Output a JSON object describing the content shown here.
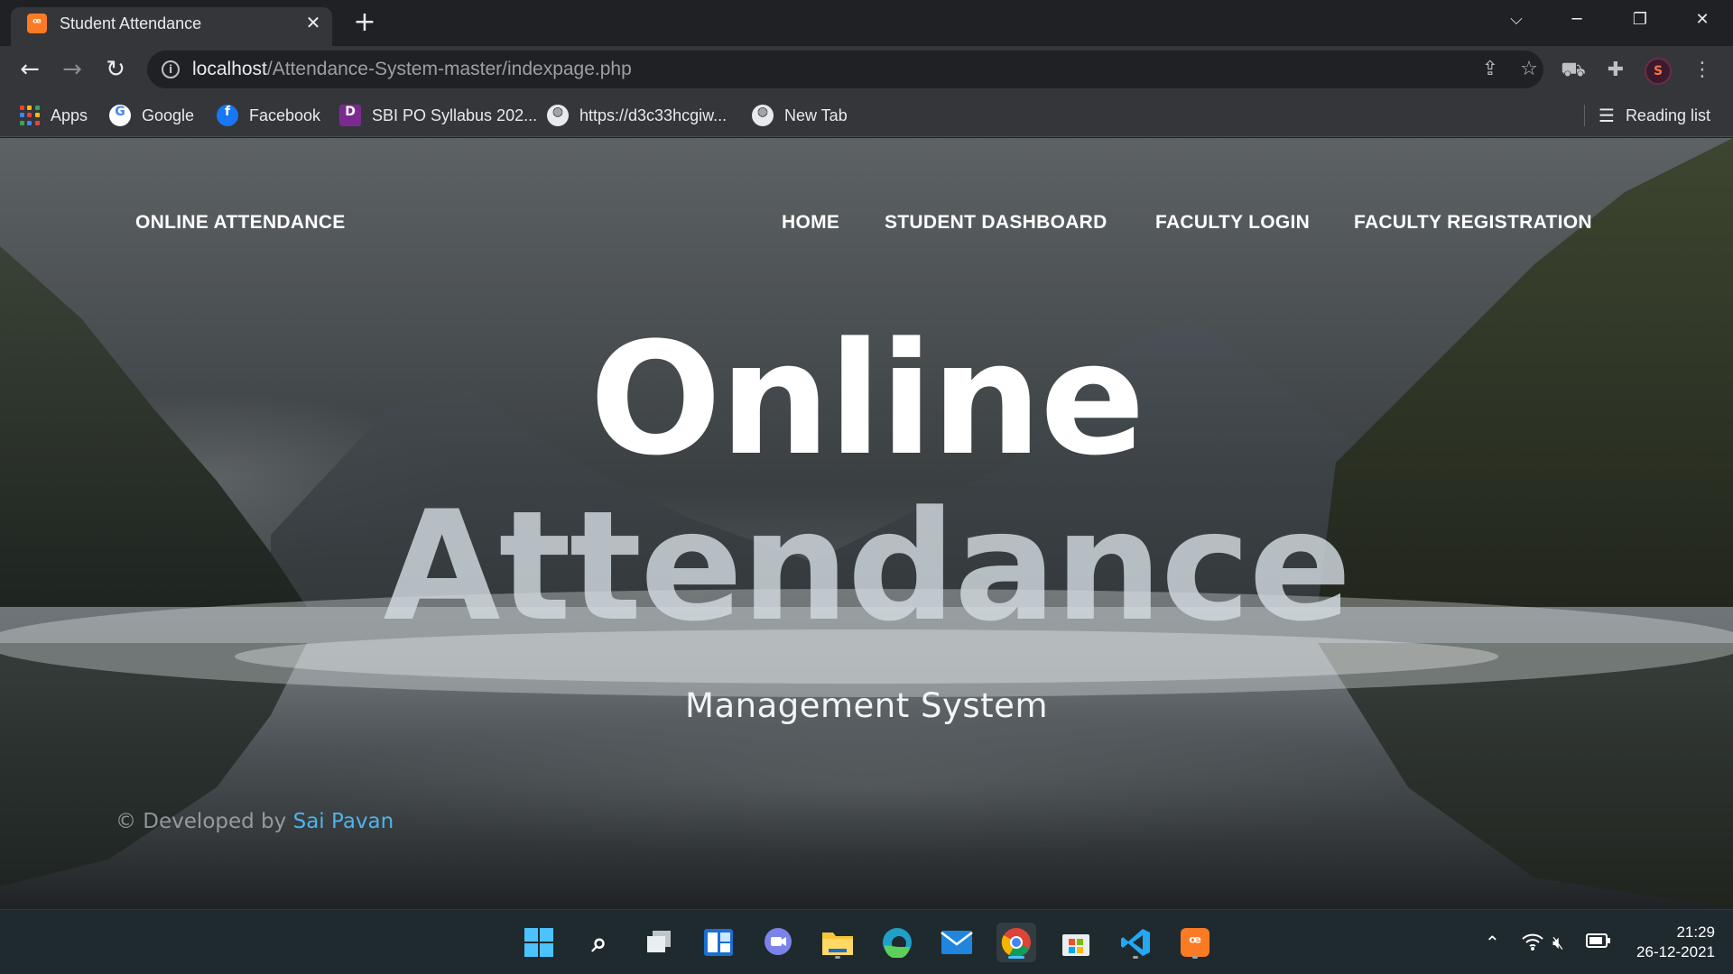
{
  "browser": {
    "tab_title": "Student Attendance",
    "tab_close": "✕",
    "new_tab": "+",
    "window_controls": {
      "tab_search": "⌵",
      "minimize": "─",
      "restore": "❐",
      "close": "✕"
    },
    "url_host": "localhost",
    "url_path": "/Attendance-System-master/indexpage.php",
    "bookmarks": [
      {
        "label": "Apps",
        "icon": "apps-grid-icon"
      },
      {
        "label": "Google",
        "icon": "google-icon"
      },
      {
        "label": "Facebook",
        "icon": "facebook-icon"
      },
      {
        "label": "SBI PO Syllabus 202...",
        "icon": "bookmark-site-icon"
      },
      {
        "label": "https://d3c33hcgiw...",
        "icon": "globe-icon"
      },
      {
        "label": "New Tab",
        "icon": "globe-icon"
      }
    ],
    "reading_list": "Reading list"
  },
  "site": {
    "brand": "ONLINE ATTENDANCE",
    "nav": [
      "HOME",
      "STUDENT DASHBOARD",
      "FACULTY LOGIN",
      "FACULTY REGISTRATION"
    ],
    "hero_line1": "Online",
    "hero_line2": "Attendance",
    "hero_subtitle": "Management System",
    "footer_prefix": "© Developed by",
    "footer_author": "Sai Pavan"
  },
  "taskbar": {
    "apps": [
      "windows-start-icon",
      "search-icon",
      "task-view-icon",
      "widgets-icon",
      "teams-chat-icon",
      "file-explorer-icon",
      "edge-icon",
      "mail-icon",
      "chrome-icon",
      "microsoft-store-icon",
      "vscode-icon",
      "xampp-icon"
    ],
    "time": "21:29",
    "date": "26-12-2021"
  }
}
